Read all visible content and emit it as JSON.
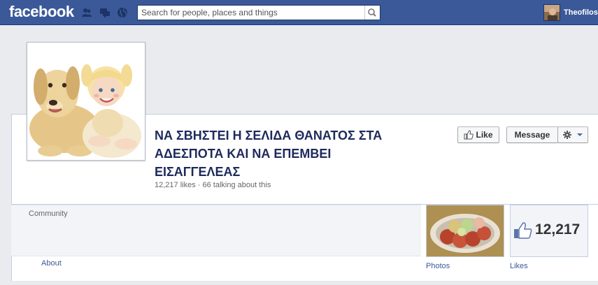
{
  "header": {
    "logo": "facebook",
    "search": {
      "placeholder": "Search for people, places and things"
    },
    "user_name": "Theofilos"
  },
  "page": {
    "title": "ΝΑ ΣΒΗΣΤΕΙ Η ΣΕΛΙΔΑ ΘΑΝΑΤΟΣ ΣΤΑ ΑΔΕΣΠΟΤΑ ΚΑΙ ΝΑ ΕΠΕΜΒΕΙ ΕΙΣΑΓΓΕΛΕΑΣ",
    "title_line1": "ΝΑ ΣΒΗΣΤΕΙ Η ΣΕΛΙΔΑ ΘΑΝΑΤΟΣ ΣΤΑ",
    "title_line2": "ΑΔΕΣΠΟΤΑ ΚΑΙ ΝΑ ΕΠΕΜΒΕΙ",
    "title_line3": "ΕΙΣΑΓΓΕΛΕΑΣ",
    "stats": "12,217 likes · 66 talking about this",
    "category": "Community"
  },
  "actions": {
    "like_label": "Like",
    "message_label": "Message"
  },
  "nav": {
    "about_label": "About"
  },
  "apps": {
    "photos_label": "Photos",
    "likes_label": "Likes",
    "likes_count": "12,217"
  },
  "colors": {
    "brand_blue": "#3b5998",
    "link_blue": "#3b5998"
  }
}
